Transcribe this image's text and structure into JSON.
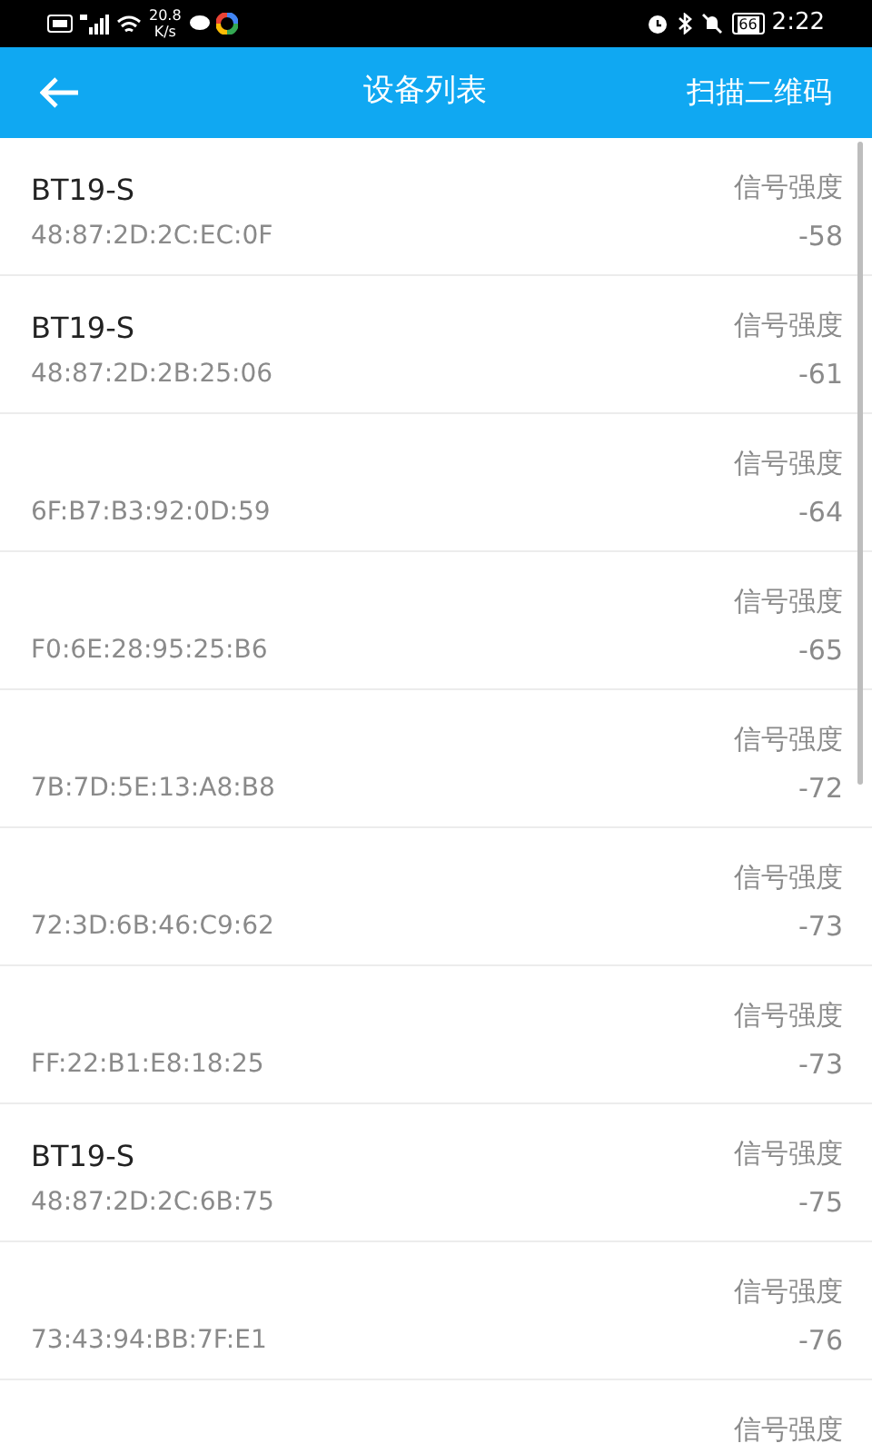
{
  "status_bar": {
    "speed_value": "20.8",
    "speed_unit": "K/s",
    "battery": "66",
    "time": "2:22"
  },
  "app_bar": {
    "title": "设备列表",
    "action": "扫描二维码"
  },
  "devices": [
    {
      "name": "BT19-S",
      "mac": "48:87:2D:2C:EC:0F",
      "signal_label": "信号强度",
      "signal": "-58"
    },
    {
      "name": "BT19-S",
      "mac": "48:87:2D:2B:25:06",
      "signal_label": "信号强度",
      "signal": "-61"
    },
    {
      "mac": "6F:B7:B3:92:0D:59",
      "signal_label": "信号强度",
      "signal": "-64"
    },
    {
      "mac": "F0:6E:28:95:25:B6",
      "signal_label": "信号强度",
      "signal": "-65"
    },
    {
      "mac": "7B:7D:5E:13:A8:B8",
      "signal_label": "信号强度",
      "signal": "-72"
    },
    {
      "mac": "72:3D:6B:46:C9:62",
      "signal_label": "信号强度",
      "signal": "-73"
    },
    {
      "mac": "FF:22:B1:E8:18:25",
      "signal_label": "信号强度",
      "signal": "-73"
    },
    {
      "name": "BT19-S",
      "mac": "48:87:2D:2C:6B:75",
      "signal_label": "信号强度",
      "signal": "-75"
    },
    {
      "mac": "73:43:94:BB:7F:E1",
      "signal_label": "信号强度",
      "signal": "-76"
    },
    {
      "signal_label": "信号强度"
    }
  ]
}
